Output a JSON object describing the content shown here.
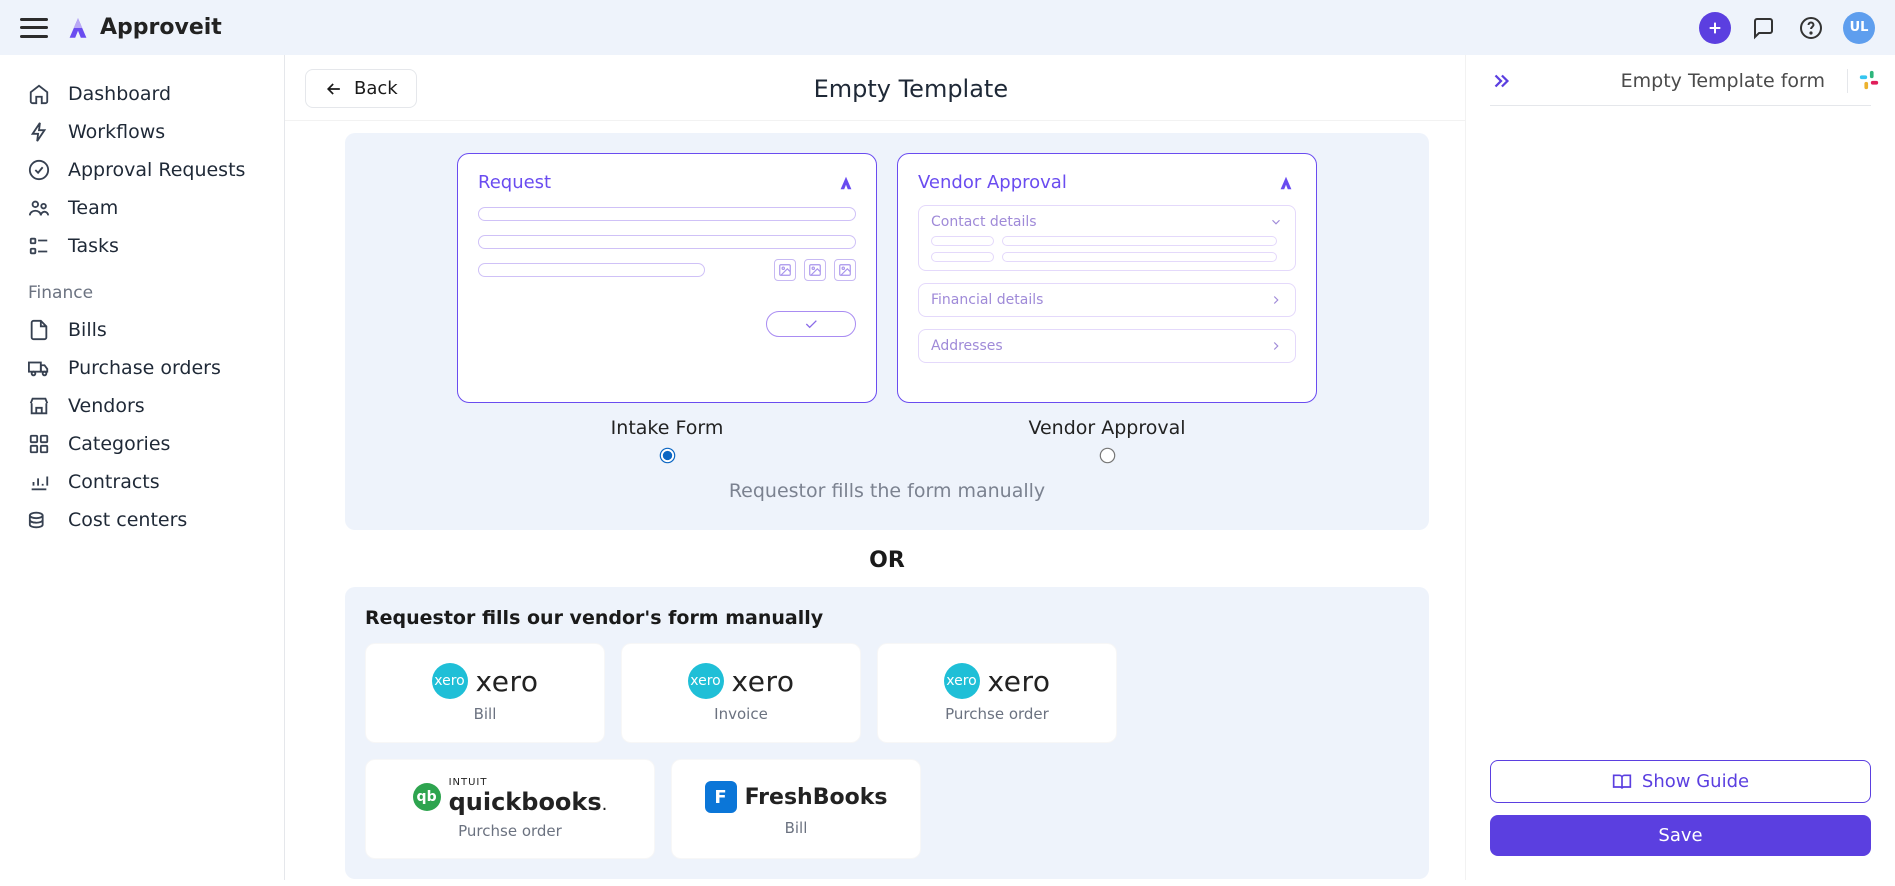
{
  "brand": {
    "name": "Approveit"
  },
  "topbar": {
    "avatar_initials": "UL"
  },
  "sidebar": {
    "nav": [
      {
        "id": "dashboard",
        "label": "Dashboard",
        "icon": "home-icon"
      },
      {
        "id": "workflows",
        "label": "Workflows",
        "icon": "bolt-icon"
      },
      {
        "id": "approval-requests",
        "label": "Approval Requests",
        "icon": "check-circle-icon"
      },
      {
        "id": "team",
        "label": "Team",
        "icon": "users-icon"
      },
      {
        "id": "tasks",
        "label": "Tasks",
        "icon": "tasks-icon"
      }
    ],
    "section_title": "Finance",
    "finance": [
      {
        "id": "bills",
        "label": "Bills",
        "icon": "file-icon"
      },
      {
        "id": "purchase-orders",
        "label": "Purchase orders",
        "icon": "truck-icon"
      },
      {
        "id": "vendors",
        "label": "Vendors",
        "icon": "store-icon"
      },
      {
        "id": "categories",
        "label": "Categories",
        "icon": "grid-icon"
      },
      {
        "id": "contracts",
        "label": "Contracts",
        "icon": "chart-icon"
      },
      {
        "id": "cost-centers",
        "label": "Cost centers",
        "icon": "coins-icon"
      }
    ]
  },
  "page": {
    "back_label": "Back",
    "title": "Empty Template",
    "form_options": {
      "intake": {
        "card_title": "Request",
        "label": "Intake Form",
        "selected": true
      },
      "vendor": {
        "card_title": "Vendor Approval",
        "sections": [
          "Contact details",
          "Financial details",
          "Addresses"
        ],
        "label": "Vendor Approval",
        "selected": false
      },
      "helper": "Requestor fills the form manually"
    },
    "or_label": "OR",
    "vendor_forms": {
      "title": "Requestor fills our vendor's form manually",
      "cards": [
        {
          "vendor": "xero",
          "label": "Bill"
        },
        {
          "vendor": "xero",
          "label": "Invoice"
        },
        {
          "vendor": "xero",
          "label": "Purchse order"
        },
        {
          "vendor": "quickbooks",
          "label": "Purchse order"
        },
        {
          "vendor": "freshbooks",
          "label": "Bill"
        }
      ]
    }
  },
  "rightpane": {
    "title": "Empty Template form",
    "show_guide_label": "Show Guide",
    "save_label": "Save"
  },
  "vendor_logos": {
    "xero": "xero",
    "quickbooks_intuit": "INTUIT",
    "quickbooks": "quickbooks",
    "freshbooks": "FreshBooks"
  }
}
